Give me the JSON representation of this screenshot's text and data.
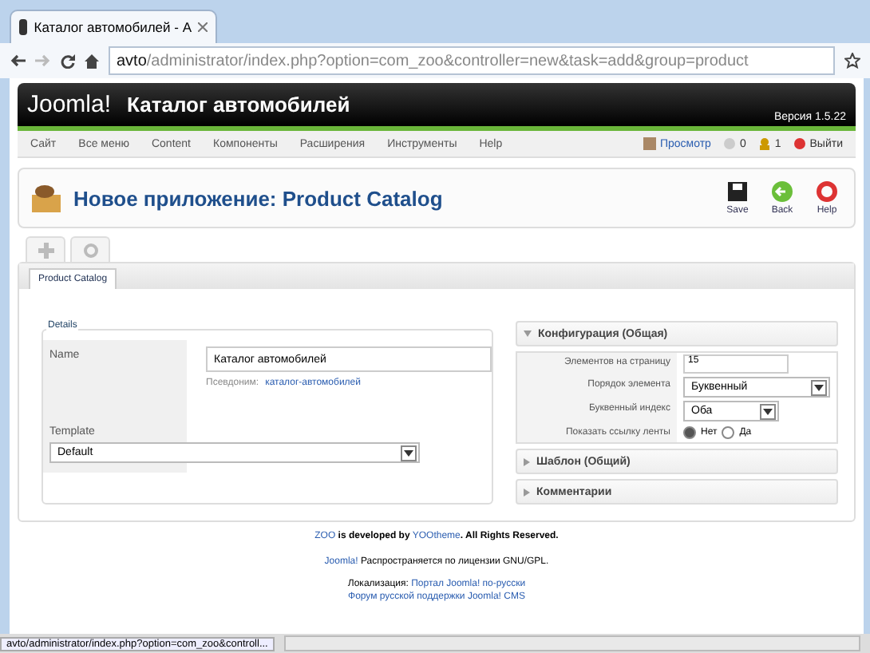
{
  "browser": {
    "tab_title": "Каталог автомобилей - А",
    "url_host": "avto",
    "url_path": "/administrator/index.php?option=com_zoo&controller=new&task=add&group=product",
    "status_url": "avto/administrator/index.php?option=com_zoo&controll..."
  },
  "header": {
    "logo": "Joomla!",
    "site_title": "Каталог автомобилей",
    "version": "Версия 1.5.22"
  },
  "menu": [
    "Сайт",
    "Все меню",
    "Content",
    "Компоненты",
    "Расширения",
    "Инструменты",
    "Help"
  ],
  "status": [
    {
      "kind": "preview",
      "label": "Просмотр"
    },
    {
      "kind": "messages",
      "label": "0"
    },
    {
      "kind": "users",
      "label": "1"
    },
    {
      "kind": "logout",
      "label": "Выйти"
    }
  ],
  "toolbar": {
    "title": "Новое приложение: Product Catalog",
    "buttons": [
      {
        "kind": "save",
        "label": "Save"
      },
      {
        "kind": "back",
        "label": "Back"
      },
      {
        "kind": "help",
        "label": "Help"
      }
    ]
  },
  "icon_tabs": [
    {
      "kind": "add"
    },
    {
      "kind": "settings"
    }
  ],
  "tabs": [
    {
      "label": "Product Catalog",
      "selected": true
    }
  ],
  "details": {
    "legend": "Details",
    "name_label": "Name",
    "name_value": "Каталог автомобилей",
    "alias_label": "Псевдоним:",
    "alias_value": "каталог-автомобилей",
    "template_label": "Template",
    "template_value": "Default"
  },
  "panels": [
    {
      "title": "Конфигурация (Общая)",
      "expanded": true,
      "rows": [
        {
          "kind": "text",
          "label": "Элементов на страницу",
          "value": "15"
        },
        {
          "kind": "select",
          "label": "Порядок элемента",
          "value": "Буквенный"
        },
        {
          "kind": "select_short",
          "label": "Буквенный индекс",
          "value": "Оба"
        },
        {
          "kind": "radio",
          "label": "Показать ссылку ленты",
          "options": [
            {
              "label": "Нет",
              "selected": true
            },
            {
              "label": "Да",
              "selected": false
            }
          ]
        }
      ]
    },
    {
      "title": "Шаблон (Общий)",
      "expanded": false
    },
    {
      "title": "Комментарии",
      "expanded": false
    }
  ],
  "footer": {
    "zoo": "ZOO",
    "dev": "is developed by",
    "yoo": "YOOtheme",
    "rights": ". All Rights Reserved.",
    "joomla": "Joomla!",
    "license": "Распространяется по лицензии GNU/GPL.",
    "loc_label": "Локализация:",
    "loc_link": "Портал Joomla! по-русски",
    "forum_link": "Форум русской поддержки Joomla! CMS"
  }
}
